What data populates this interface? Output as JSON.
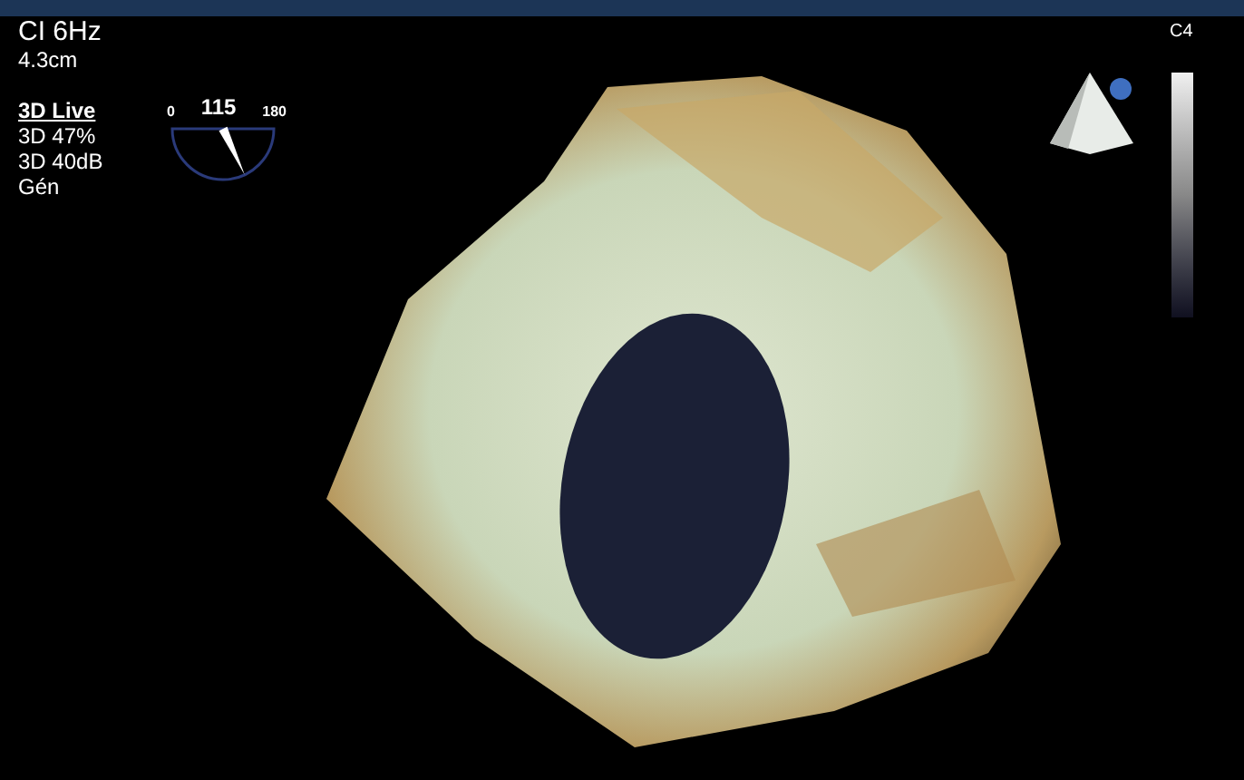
{
  "settings": [
    {
      "text": "CI 6Hz",
      "kind": "title"
    },
    {
      "text": "4.3cm",
      "kind": "value"
    },
    {
      "text": "3D Live",
      "kind": "mode"
    },
    {
      "text": "3D 47%",
      "kind": "value"
    },
    {
      "text": "3D 40dB",
      "kind": "value"
    },
    {
      "text": "Gén",
      "kind": "value"
    }
  ],
  "angle_dial": {
    "min": "0",
    "value": "115",
    "max": "180",
    "level": 0.64
  },
  "grayscale_bar": {
    "label": "C4"
  }
}
